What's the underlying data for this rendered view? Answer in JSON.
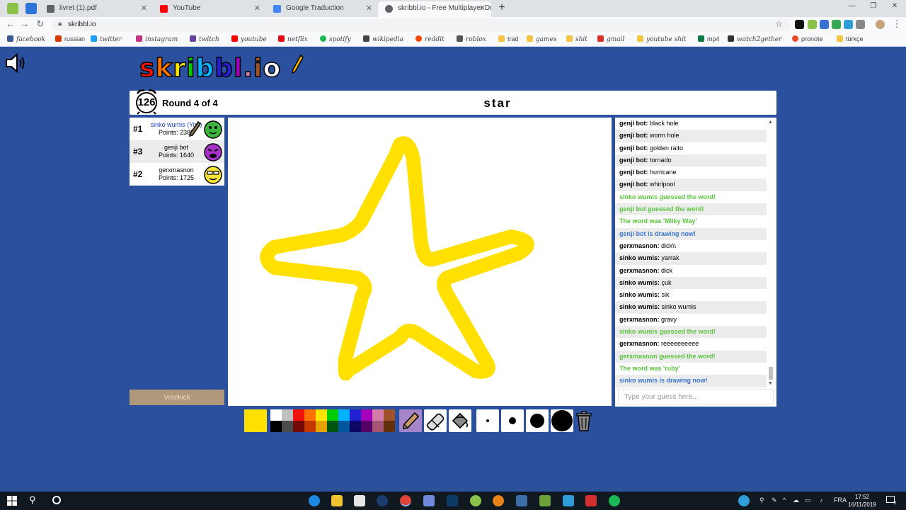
{
  "browser": {
    "tabs": [
      {
        "title": "livret (1).pdf",
        "favicon_color": "#5f6368",
        "active": false
      },
      {
        "title": "YouTube",
        "favicon_color": "#ff0000",
        "active": false
      },
      {
        "title": "Google Traduction",
        "favicon_color": "#4285f4",
        "active": false
      },
      {
        "title": "skribbl.io - Free Multiplayer Drawing",
        "favicon_color": "#5f6368",
        "active": true
      }
    ],
    "url": "skribbl.io"
  },
  "bookmarks": [
    {
      "label": "facebook",
      "icon_color": "#3b5998",
      "stylized": true
    },
    {
      "label": "russian",
      "icon_color": "#d83b01",
      "stylized": false
    },
    {
      "label": "twitter",
      "icon_color": "#1da1f2",
      "stylized": true
    },
    {
      "label": "instagram",
      "icon_color": "#c13584",
      "stylized": true
    },
    {
      "label": "twitch",
      "icon_color": "#6441a5",
      "stylized": true
    },
    {
      "label": "youtube",
      "icon_color": "#ff0000",
      "stylized": true
    },
    {
      "label": "netflix",
      "icon_color": "#e50914",
      "stylized": true
    },
    {
      "label": "spotify",
      "icon_color": "#1db954",
      "stylized": true
    },
    {
      "label": "wikipedia",
      "icon_color": "#444444",
      "stylized": true
    },
    {
      "label": "reddit",
      "icon_color": "#ff4500",
      "stylized": true
    },
    {
      "label": "roblox",
      "icon_color": "#555555",
      "stylized": true
    },
    {
      "label": "trad",
      "icon_color": "#f4c542",
      "stylized": false
    },
    {
      "label": "games",
      "icon_color": "#f4c542",
      "stylized": true
    },
    {
      "label": "shit",
      "icon_color": "#f4c542",
      "stylized": true
    },
    {
      "label": "gmail",
      "icon_color": "#d93025",
      "stylized": true
    },
    {
      "label": "youtube shit",
      "icon_color": "#f4c542",
      "stylized": true
    },
    {
      "label": "mp4",
      "icon_color": "#107c41",
      "stylized": false
    },
    {
      "label": "watch2gether",
      "icon_color": "#333333",
      "stylized": true
    },
    {
      "label": "pronote",
      "icon_color": "#ea4c2b",
      "stylized": false
    },
    {
      "label": "türkçe",
      "icon_color": "#f4c542",
      "stylized": false
    }
  ],
  "game": {
    "logo": "skribbl.io",
    "timer": "126",
    "round": "Round 4 of 4",
    "word": "star",
    "players": [
      {
        "rank": "#1",
        "name": "sinko wumis (You)",
        "points": "Points: 2385",
        "is_me": true,
        "avatar_color": "#3cb53c",
        "drawing": true
      },
      {
        "rank": "#3",
        "name": "genji bot",
        "points": "Points: 1640",
        "is_me": false,
        "avatar_color": "#a832c8",
        "drawing": false
      },
      {
        "rank": "#2",
        "name": "gerxmasnon",
        "points": "Points: 1725",
        "is_me": false,
        "avatar_color": "#f7e436",
        "drawing": false
      }
    ],
    "votekick": "Votekick",
    "drawing_color": "#ffe000",
    "chat": [
      {
        "type": "normal",
        "who": "genji bot:",
        "text": "black hole"
      },
      {
        "type": "normal",
        "who": "genji bot:",
        "text": "worm hole"
      },
      {
        "type": "normal",
        "who": "genji bot:",
        "text": "golden raito"
      },
      {
        "type": "normal",
        "who": "genji bot:",
        "text": "tornado"
      },
      {
        "type": "normal",
        "who": "genji bot:",
        "text": "hurricane"
      },
      {
        "type": "normal",
        "who": "genji bot:",
        "text": "whirlpool"
      },
      {
        "type": "green",
        "who": "",
        "text": "sinko wumis guessed the word!"
      },
      {
        "type": "green",
        "who": "",
        "text": "genji bot guessed the word!"
      },
      {
        "type": "green",
        "who": "",
        "text": "The word was 'Milky Way'"
      },
      {
        "type": "blue",
        "who": "",
        "text": "genji bot is drawing now!"
      },
      {
        "type": "normal",
        "who": "gerxmasnon:",
        "text": "dick\\\\"
      },
      {
        "type": "normal",
        "who": "sinko wumis:",
        "text": "yarrak"
      },
      {
        "type": "normal",
        "who": "gerxmasnon:",
        "text": "dick"
      },
      {
        "type": "normal",
        "who": "sinko wumis:",
        "text": "çuk"
      },
      {
        "type": "normal",
        "who": "sinko wumis:",
        "text": "sik"
      },
      {
        "type": "normal",
        "who": "sinko wumis:",
        "text": "sinko wumis"
      },
      {
        "type": "normal",
        "who": "gerxmasnon:",
        "text": "gravy"
      },
      {
        "type": "green",
        "who": "",
        "text": "sinko wumis guessed the word!"
      },
      {
        "type": "normal",
        "who": "gerxmasnon:",
        "text": "reeeeeeeeee"
      },
      {
        "type": "green",
        "who": "",
        "text": "gerxmasnon guessed the word!"
      },
      {
        "type": "green",
        "who": "",
        "text": "The word was 'ruby'"
      },
      {
        "type": "blue",
        "who": "",
        "text": "sinko wumis is drawing now!"
      }
    ],
    "chat_placeholder": "Type your guess here...",
    "palette": {
      "row1": [
        "#ffffff",
        "#c1c1c1",
        "#ef130b",
        "#ff7100",
        "#ffe400",
        "#00cc00",
        "#00b2ff",
        "#231fd3",
        "#a300ba",
        "#d37caa",
        "#a0522d"
      ],
      "row2": [
        "#000000",
        "#4c4c4c",
        "#740b07",
        "#c23800",
        "#e8a200",
        "#005510",
        "#00569e",
        "#0e0865",
        "#550069",
        "#a75574",
        "#63300d"
      ]
    },
    "tools": [
      "pencil-tool",
      "eraser-tool",
      "fill-tool"
    ],
    "brush_sizes": [
      "small",
      "medium",
      "large",
      "xlarge"
    ]
  },
  "taskbar": {
    "language": "FRA",
    "time": "17:52",
    "date": "16/11/2019",
    "notifications": "3"
  }
}
